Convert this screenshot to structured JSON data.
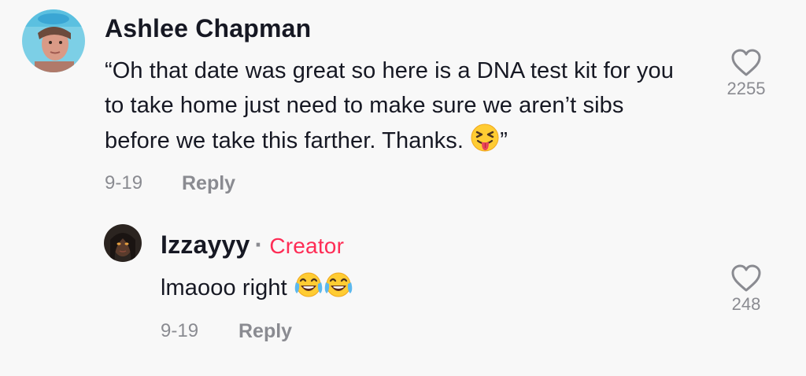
{
  "comments": [
    {
      "author": "Ashlee Chapman",
      "text": "“Oh that date was great so here is a DNA test kit for you to take home just need to make sure we aren’t sibs before we take this farther. Thanks.",
      "text_end": "”",
      "emoji": "squinting-face-with-tongue",
      "date": "9-19",
      "reply_label": "Reply",
      "likes": "2255"
    },
    {
      "author": "Izzayyy",
      "badge": "Creator",
      "separator": "·",
      "text": "lmaooo right",
      "emoji": "face-with-tears-of-joy",
      "date": "9-19",
      "reply_label": "Reply",
      "likes": "248"
    }
  ],
  "colors": {
    "background": "#f8f8f8",
    "text": "#161823",
    "muted": "#8a8b91",
    "creator": "#fe2c55"
  }
}
